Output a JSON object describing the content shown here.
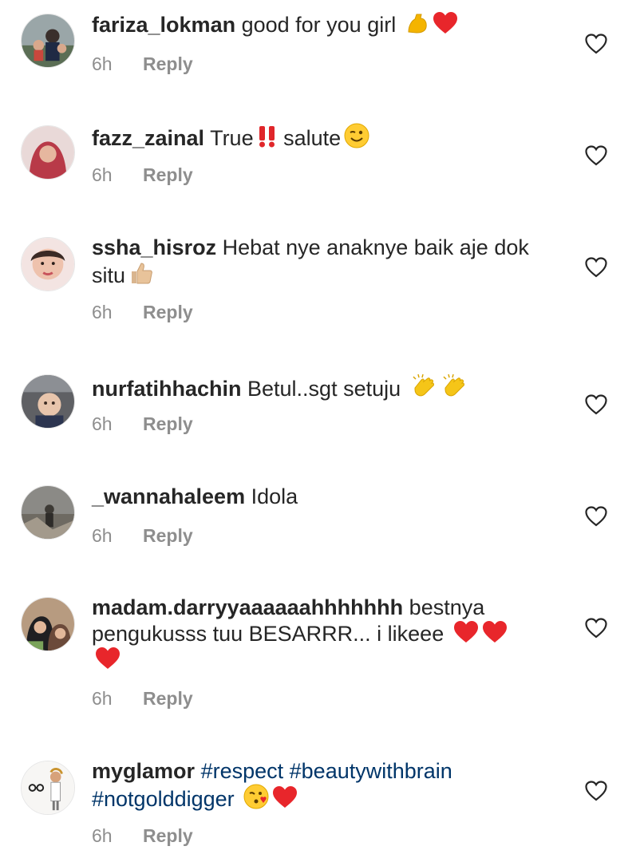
{
  "comments": [
    {
      "username": "fariza_lokman",
      "segments": [
        {
          "text": "good for you girl"
        }
      ],
      "emojis": [
        "flexed-biceps-emoji",
        "red-heart-emoji"
      ],
      "time": "6h",
      "reply": "Reply"
    },
    {
      "username": "fazz_zainal",
      "segments": [
        {
          "text": "True"
        }
      ],
      "mid_emojis": [
        "double-exclamation-emoji"
      ],
      "segments2": [
        {
          "text": "salute"
        }
      ],
      "emojis": [
        "winking-face-emoji"
      ],
      "time": "6h",
      "reply": "Reply"
    },
    {
      "username": "ssha_hisroz",
      "segments": [
        {
          "text": "Hebat nye anaknye baik aje dok situ"
        }
      ],
      "emojis": [
        "thumbs-up-emoji"
      ],
      "time": "6h",
      "reply": "Reply"
    },
    {
      "username": "nurfatihhachin",
      "segments": [
        {
          "text": "Betul..sgt setuju"
        }
      ],
      "emojis": [
        "clapping-hands-emoji",
        "clapping-hands-emoji"
      ],
      "time": "6h",
      "reply": "Reply"
    },
    {
      "username": "_wannahaleem",
      "segments": [
        {
          "text": "Idola"
        }
      ],
      "emojis": [],
      "time": "6h",
      "reply": "Reply"
    },
    {
      "username": "madam.darryyaaaaaahhhhhhh",
      "segments": [
        {
          "text": "bestnya pengukusss tuu BESARRR... i likeee"
        }
      ],
      "emojis": [
        "red-heart-emoji",
        "red-heart-emoji",
        "red-heart-emoji"
      ],
      "time": "6h",
      "reply": "Reply"
    },
    {
      "username": "myglamor",
      "hashtags": [
        "#respect",
        "#beautywithbrain",
        "#notgolddigger"
      ],
      "emojis": [
        "face-blowing-kiss-emoji",
        "red-heart-emoji"
      ],
      "time": "6h",
      "reply": "Reply"
    }
  ],
  "colors": {
    "text": "#262626",
    "meta": "#8e8e8e",
    "hashtag": "#003569",
    "heart_outline": "#262626"
  }
}
